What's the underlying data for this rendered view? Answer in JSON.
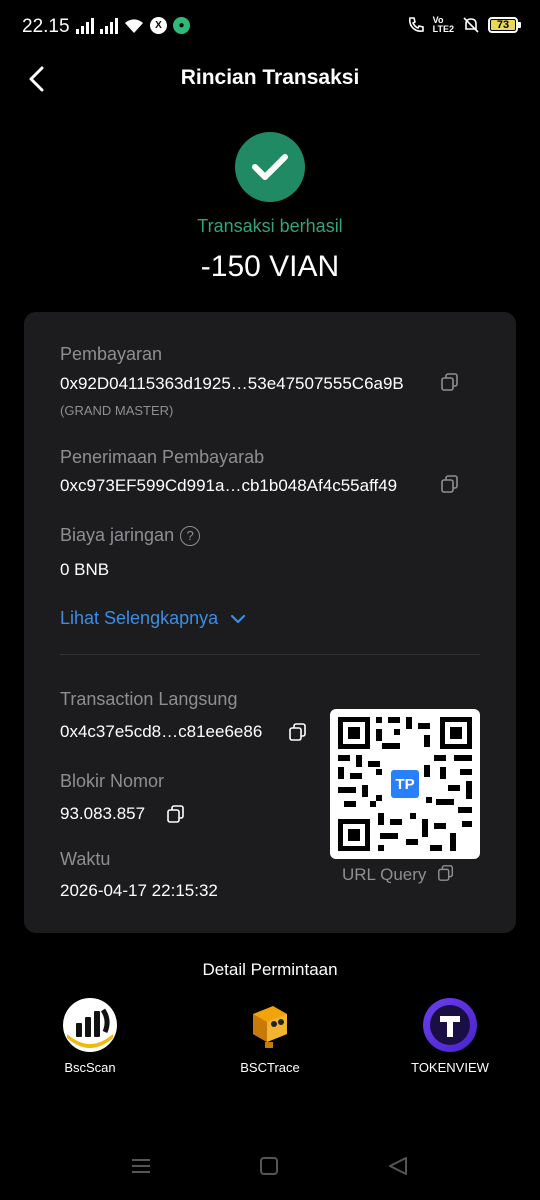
{
  "status_bar": {
    "time": "22.15",
    "volte_label_top": "Vo",
    "volte_label_bottom": "LTE2",
    "battery": "73",
    "notif_x": "X"
  },
  "header": {
    "title": "Rincian Transaksi"
  },
  "result": {
    "status": "Transaksi berhasil",
    "amount": "-150 VIAN",
    "status_color": "#1f8a64"
  },
  "details": {
    "payment_label": "Pembayaran",
    "payment_address": "0x92D04115363d1925…53e47507555C6a9B",
    "payment_tag": "(GRAND MASTER)",
    "receiver_label": "Penerimaan Pembayarab",
    "receiver_address": "0xc973EF599Cd991a…cb1b048Af4c55aff49",
    "fee_label": "Biaya jaringan",
    "fee_help": "?",
    "fee_value": "0 BNB",
    "more_label": "Lihat Selengkapnya",
    "tx_label": "Transaction Langsung",
    "tx_hash": "0x4c37e5cd8…c81ee6e86",
    "block_label": "Blokir Nomor",
    "block_value": "93.083.857",
    "time_label": "Waktu",
    "time_value": "2026-04-17 22:15:32",
    "qr_badge": "TP",
    "qr_caption": "URL Query"
  },
  "explorers": {
    "title": "Detail Permintaan",
    "items": [
      {
        "name": "BscScan",
        "icon": "bscscan-icon"
      },
      {
        "name": "BSCTrace",
        "icon": "bsctrace-icon"
      },
      {
        "name": "TOKENVIEW",
        "icon": "tokenview-icon"
      }
    ]
  },
  "accent_color": "#3a8ee6"
}
